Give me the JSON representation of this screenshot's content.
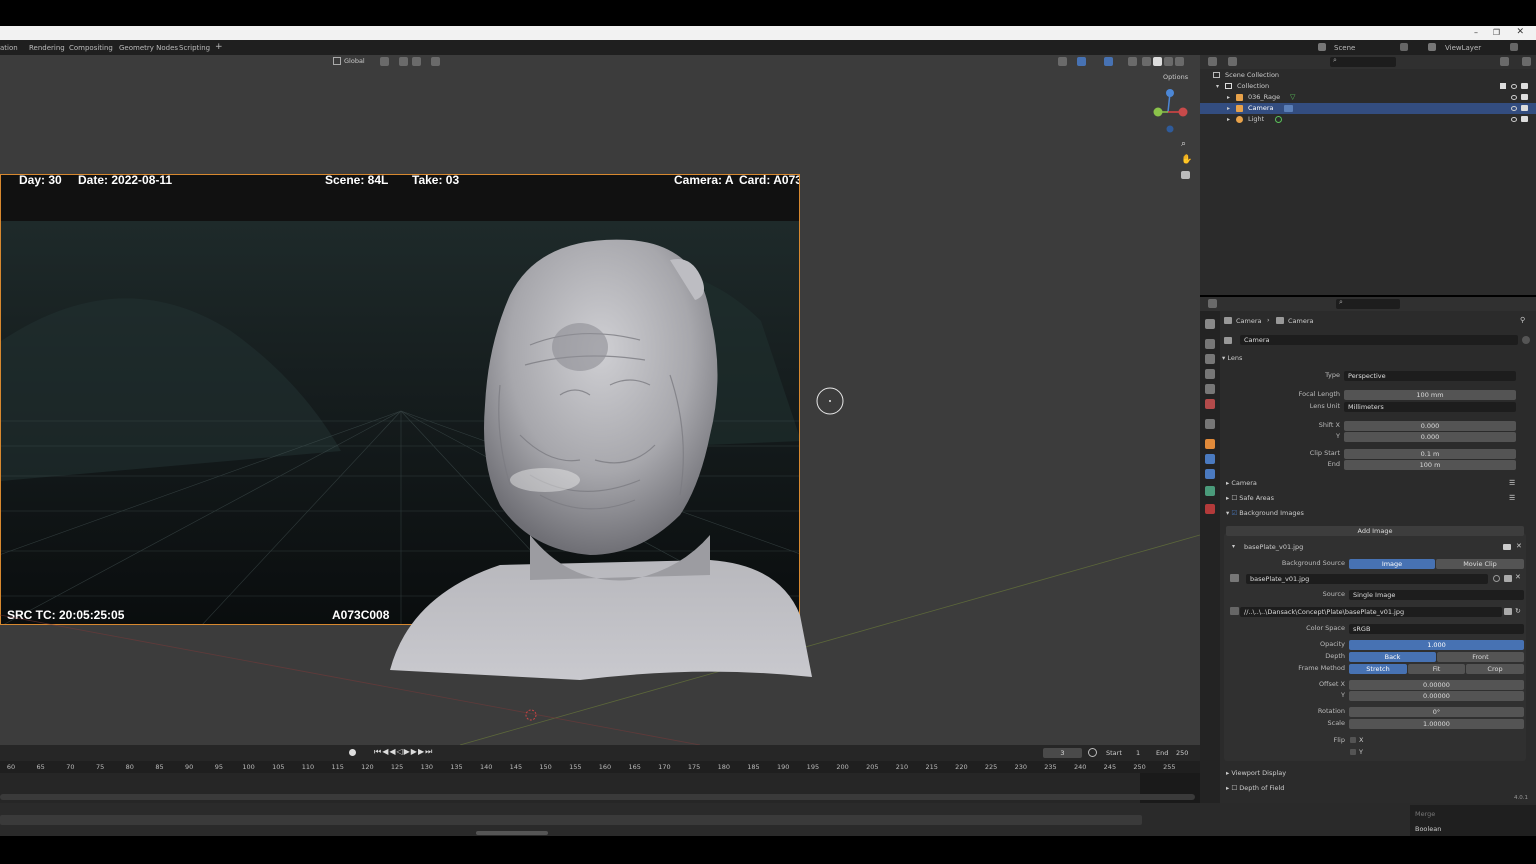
{
  "workspace_tabs": [
    "ation",
    "Rendering",
    "Compositing",
    "Geometry Nodes",
    "Scripting",
    "+"
  ],
  "scene": {
    "label": "Scene",
    "viewlayer": "ViewLayer"
  },
  "viewport_header": {
    "transform": "Global",
    "options": "Options"
  },
  "slate": {
    "day": "Day: 30",
    "date": "Date: 2022-08-11",
    "scene": "Scene: 84L",
    "take": "Take: 03",
    "camera": "Camera: A",
    "card": "Card: A073",
    "tc": "SRC TC: 20:05:25:05",
    "clip": "A073C008"
  },
  "outliner": {
    "root": "Scene Collection",
    "collection": "Collection",
    "items": [
      {
        "name": "036_Rage",
        "icon": "mesh-icon",
        "color": "#e8a24a",
        "selected": false
      },
      {
        "name": "Camera",
        "icon": "camera-icon",
        "color": "#e8a24a",
        "selected": true
      },
      {
        "name": "Light",
        "icon": "light-icon",
        "color": "#e8a24a",
        "selected": false
      }
    ]
  },
  "properties": {
    "breadcrumb": [
      "Camera",
      "Camera"
    ],
    "datablock": "Camera",
    "lens": {
      "title": "Lens",
      "type_label": "Type",
      "type_value": "Perspective",
      "focal_label": "Focal Length",
      "focal_value": "100 mm",
      "unit_label": "Lens Unit",
      "unit_value": "Millimeters",
      "shiftx_label": "Shift X",
      "shiftx_value": "0.000",
      "shifty_label": "Y",
      "shifty_value": "0.000",
      "clipstart_label": "Clip Start",
      "clipstart_value": "0.1 m",
      "clipend_label": "End",
      "clipend_value": "100 m"
    },
    "sections": {
      "camera": "Camera",
      "safe_areas": "Safe Areas",
      "bg_images": "Background Images",
      "viewport_display": "Viewport Display",
      "dof": "Depth of Field"
    },
    "bg": {
      "add_image": "Add Image",
      "file": "basePlate_v01.jpg",
      "source_label": "Background Source",
      "source_image": "Image",
      "source_movie": "Movie Clip",
      "image_name": "basePlate_v01.jpg",
      "src_label": "Source",
      "src_value": "Single Image",
      "path": "//..\\..\\..\\Dansack\\Concept\\Plate\\basePlate_v01.jpg",
      "colorspace_label": "Color Space",
      "colorspace_value": "sRGB",
      "opacity_label": "Opacity",
      "opacity_value": "1.000",
      "depth_label": "Depth",
      "depth_back": "Back",
      "depth_front": "Front",
      "frame_label": "Frame Method",
      "frame_stretch": "Stretch",
      "frame_fit": "Fit",
      "frame_crop": "Crop",
      "offx_label": "Offset X",
      "offx_value": "0.00000",
      "offy_label": "Y",
      "offy_value": "0.00000",
      "rot_label": "Rotation",
      "rot_value": "0°",
      "scale_label": "Scale",
      "scale_value": "1.00000",
      "flip_label": "Flip",
      "flip_x": "X",
      "flip_y": "Y"
    },
    "version": "4.0.1"
  },
  "timeline": {
    "current_frame": "3",
    "start_label": "Start",
    "start_value": "1",
    "end_label": "End",
    "end_value": "250",
    "ticks": [
      "60",
      "65",
      "70",
      "75",
      "80",
      "85",
      "90",
      "95",
      "100",
      "105",
      "110",
      "115",
      "120",
      "125",
      "130",
      "135",
      "140",
      "145",
      "150",
      "155",
      "160",
      "165",
      "170",
      "175",
      "180",
      "185",
      "190",
      "195",
      "200",
      "205",
      "210",
      "215",
      "220",
      "225",
      "230",
      "235",
      "240",
      "245",
      "250",
      "255"
    ]
  },
  "bottom_menu": {
    "merge": "Merge",
    "boolean": "Boolean"
  },
  "colors": {
    "accent": "#4772b3",
    "frame_border": "#d7882f",
    "selected_row": "#334d80"
  }
}
